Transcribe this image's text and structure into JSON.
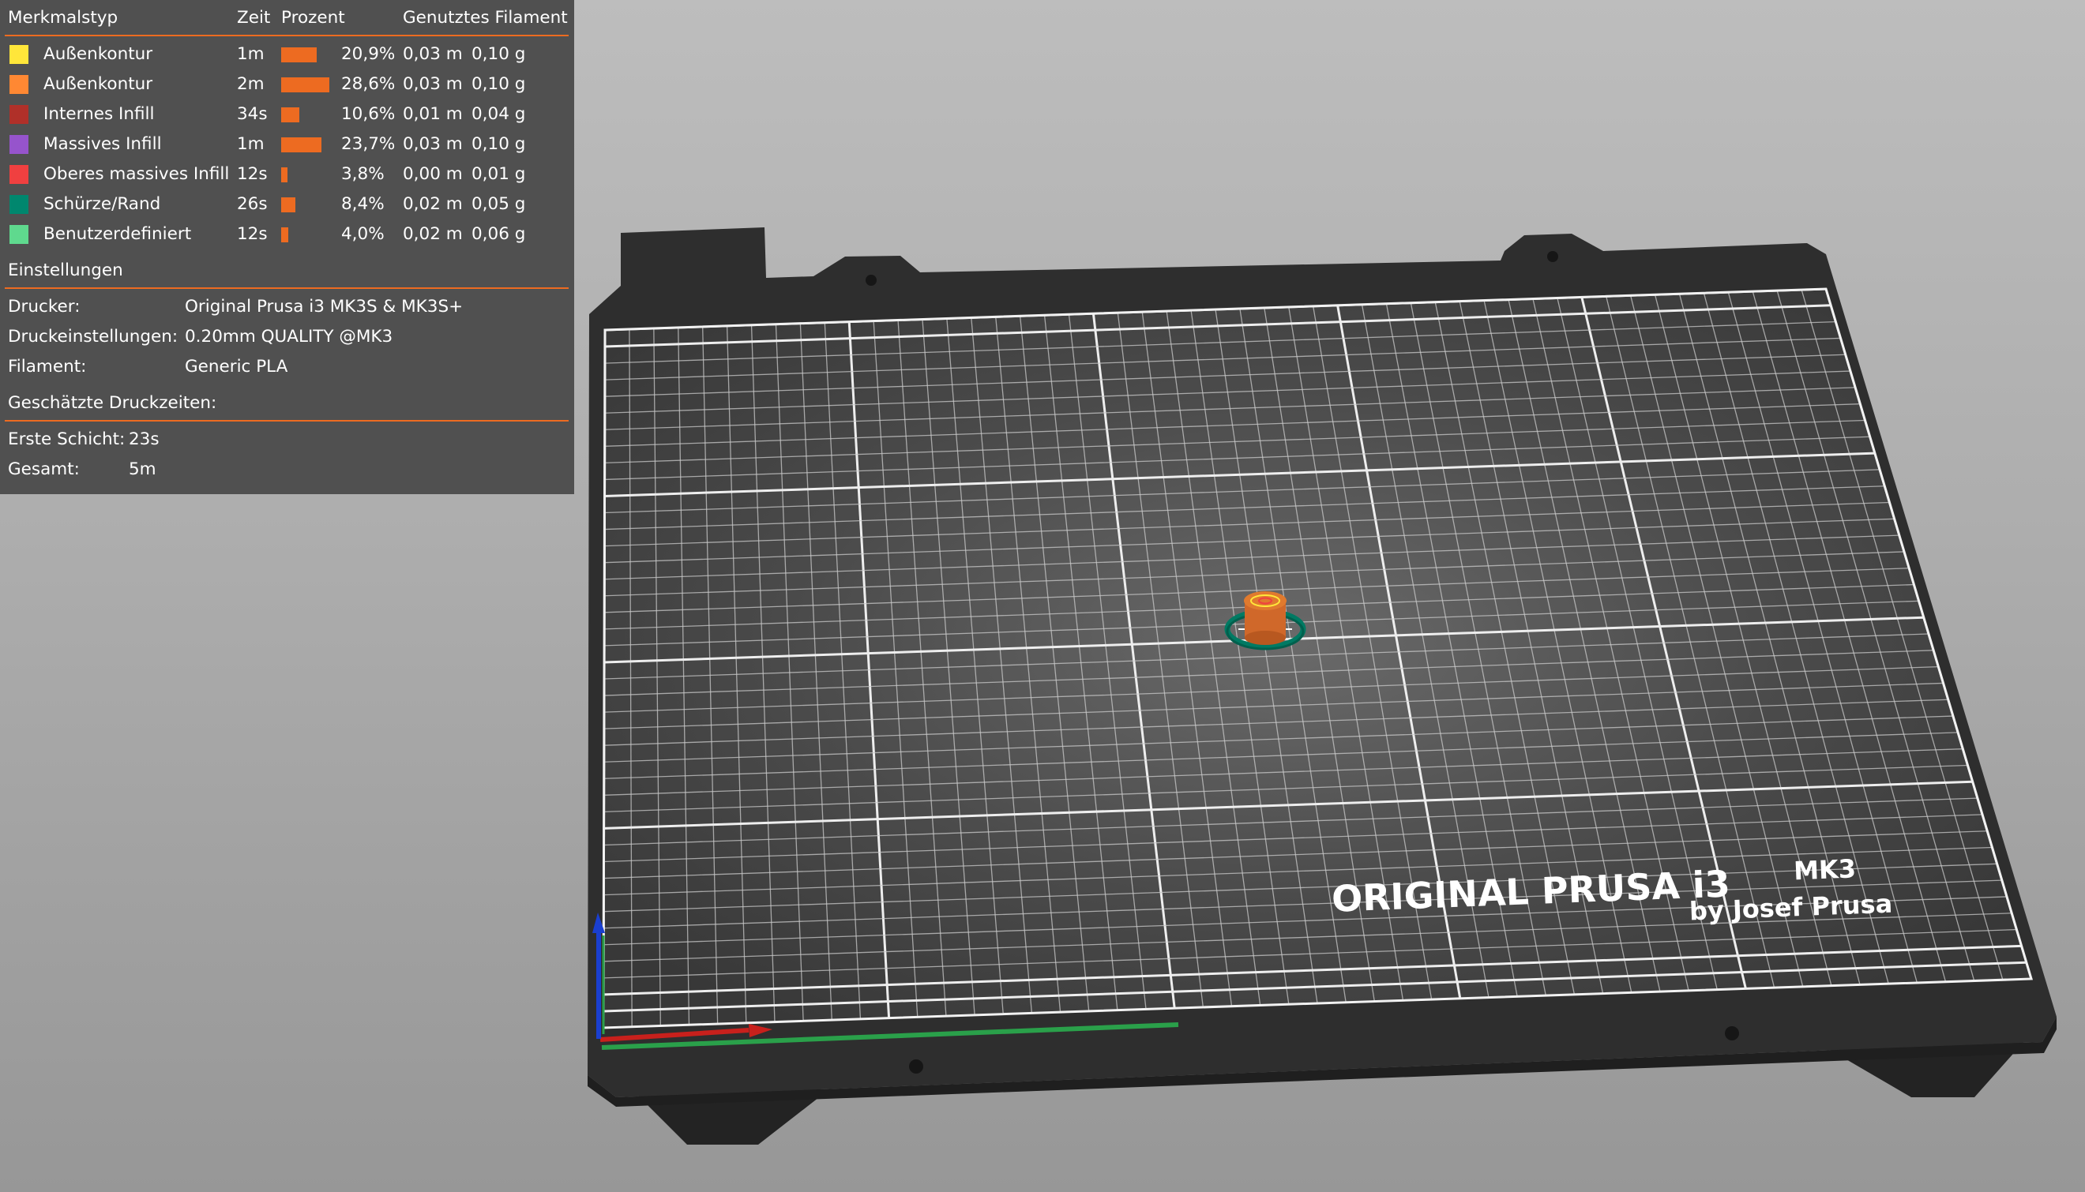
{
  "legend": {
    "headers": {
      "feature": "Merkmalstyp",
      "time": "Zeit",
      "percent": "Prozent",
      "filament": "Genutztes Filament"
    },
    "rows": [
      {
        "color": "#ffe63a",
        "name": "Außenkontur",
        "time": "1m",
        "percent": "20,9%",
        "percent_value": 20.9,
        "length": "0,03 m",
        "weight": "0,10 g"
      },
      {
        "color": "#ff8833",
        "name": "Außenkontur",
        "time": "2m",
        "percent": "28,6%",
        "percent_value": 28.6,
        "length": "0,03 m",
        "weight": "0,10 g"
      },
      {
        "color": "#b03029",
        "name": "Internes Infill",
        "time": "34s",
        "percent": "10,6%",
        "percent_value": 10.6,
        "length": "0,01 m",
        "weight": "0,04 g"
      },
      {
        "color": "#9654cc",
        "name": "Massives Infill",
        "time": "1m",
        "percent": "23,7%",
        "percent_value": 23.7,
        "length": "0,03 m",
        "weight": "0,10 g"
      },
      {
        "color": "#f04040",
        "name": "Oberes massives Infill",
        "time": "12s",
        "percent": "3,8%",
        "percent_value": 3.8,
        "length": "0,00 m",
        "weight": "0,01 g"
      },
      {
        "color": "#00876e",
        "name": "Schürze/Rand",
        "time": "26s",
        "percent": "8,4%",
        "percent_value": 8.4,
        "length": "0,02 m",
        "weight": "0,05 g"
      },
      {
        "color": "#5fd98e",
        "name": "Benutzerdefiniert",
        "time": "12s",
        "percent": "4,0%",
        "percent_value": 4.0,
        "length": "0,02 m",
        "weight": "0,06 g"
      }
    ]
  },
  "settings": {
    "title": "Einstellungen",
    "printer_label": "Drucker:",
    "printer_value": "Original Prusa i3 MK3S & MK3S+",
    "print_settings_label": "Druckeinstellungen:",
    "print_settings_value": "0.20mm QUALITY @MK3",
    "filament_label": "Filament:",
    "filament_value": "Generic PLA"
  },
  "times": {
    "title": "Geschätzte Druckzeiten:",
    "first_layer_label": "Erste Schicht:",
    "first_layer_value": "23s",
    "total_label": "Gesamt:",
    "total_value": "5m"
  },
  "bed": {
    "brand_line1": "ORIGINAL PRUSA i3",
    "brand_model": "MK3",
    "brand_line2": "by Josef Prusa"
  },
  "colors": {
    "accent": "#ed6b21",
    "panel_bg": "#505050",
    "bed_frame": "#2e2e2e",
    "axis_x": "#c8201c",
    "axis_y": "#2aa04a",
    "axis_z": "#1a3fd0"
  }
}
